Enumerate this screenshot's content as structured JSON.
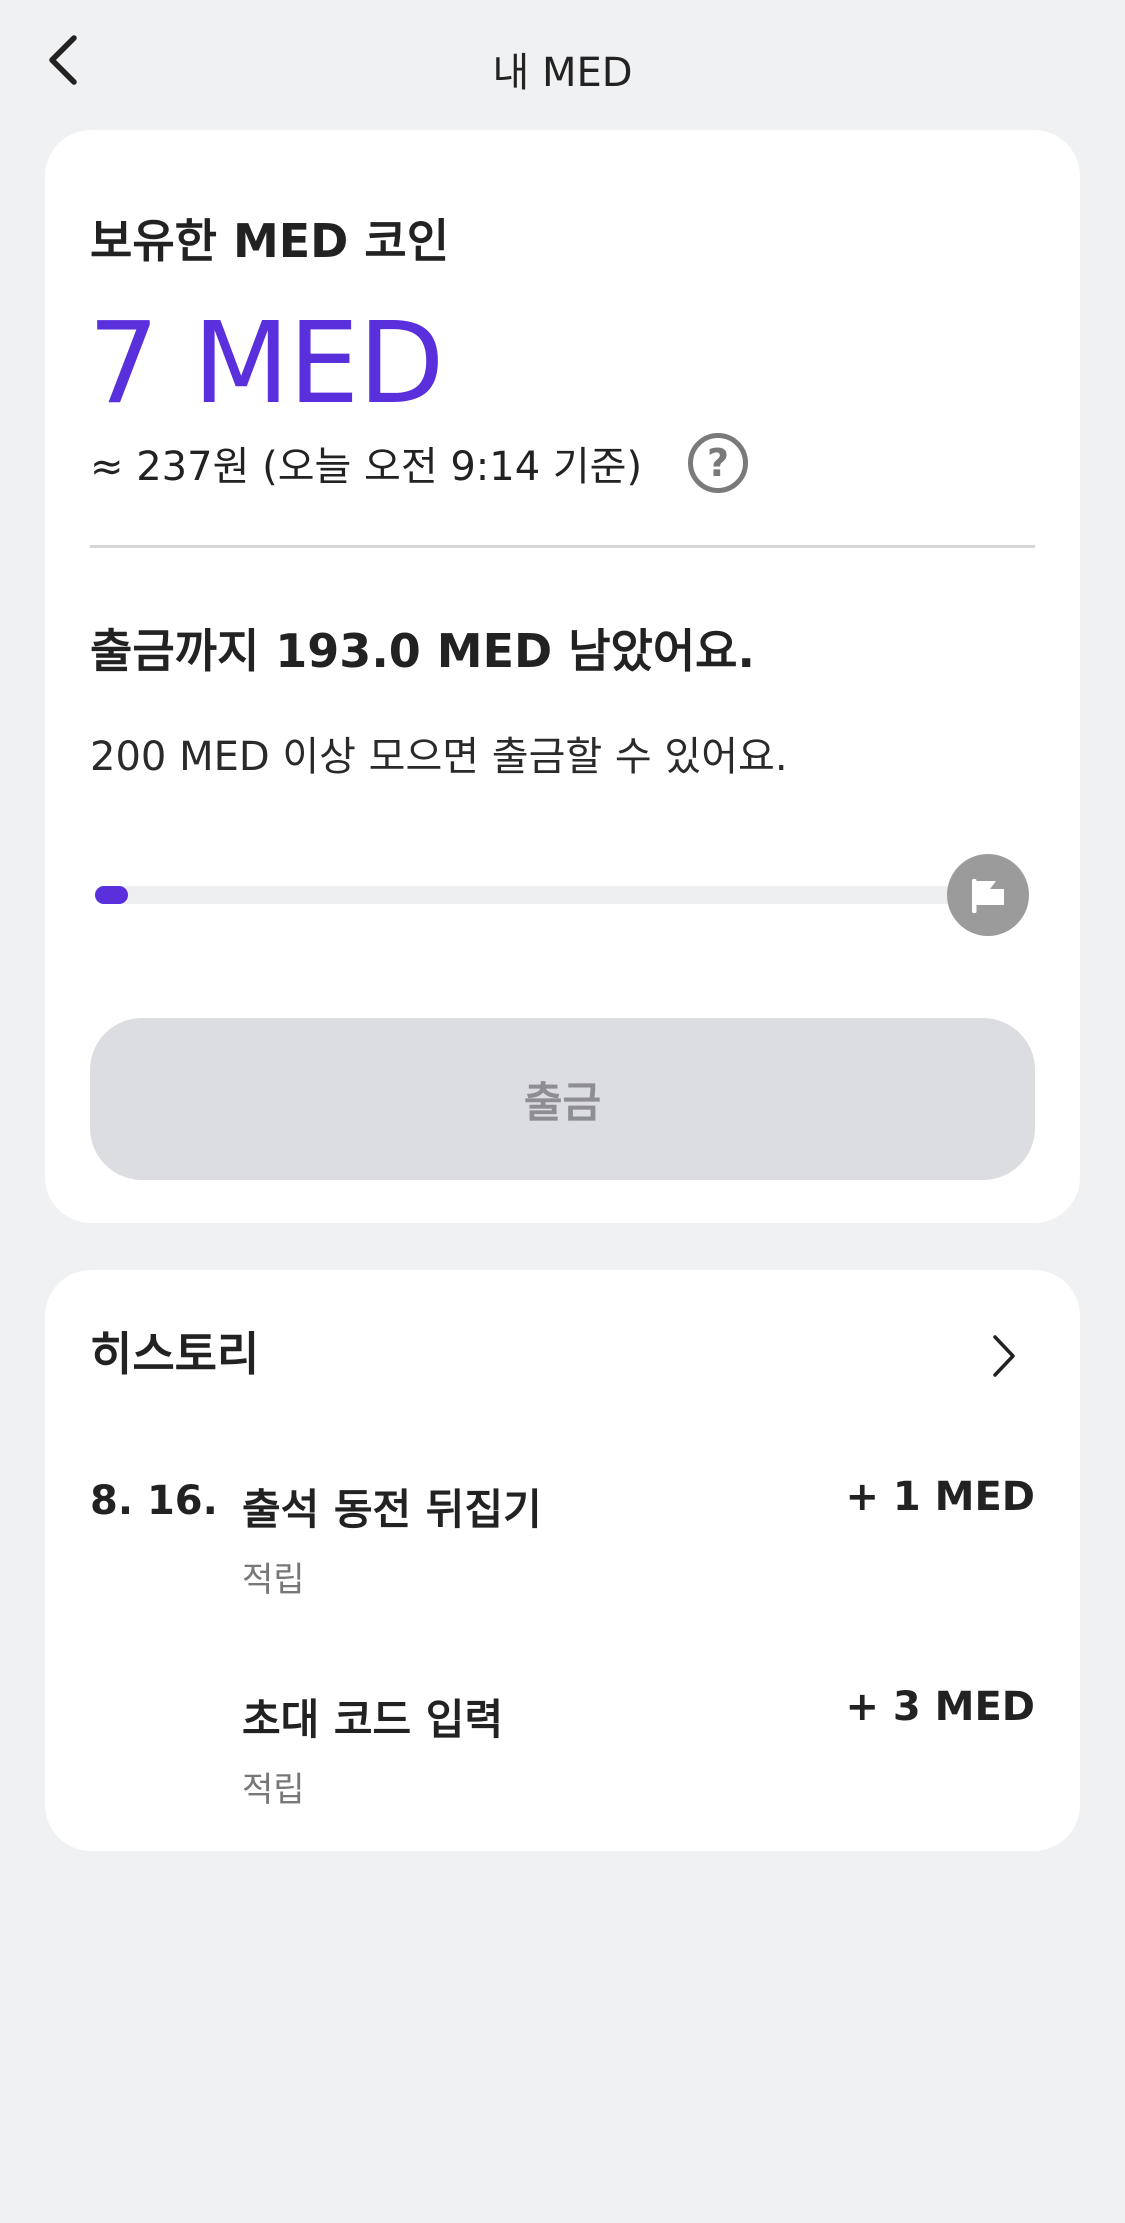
{
  "header": {
    "title": "내 MED",
    "back_icon": "chevron-left-icon"
  },
  "balance": {
    "label": "보유한 MED 코인",
    "amount": "7 MED",
    "krw_estimate": "≈ 237원 (오늘 오전 9:14 기준)",
    "help_icon_glyph": "?",
    "accent_color": "#5a2fdc"
  },
  "withdraw": {
    "remaining_title": "출금까지 193.0 MED 남았어요.",
    "condition_text": "200 MED 이상 모으면 출금할 수 있어요.",
    "progress_fraction": 0.035,
    "goal_icon": "flag-icon",
    "button_label": "출금",
    "button_enabled": false
  },
  "history": {
    "title": "히스토리",
    "more_icon": "chevron-right-icon",
    "items": [
      {
        "date": "8. 16.",
        "title": "출석 동전 뒤집기",
        "type": "적립",
        "amount": "+ 1 MED"
      },
      {
        "date": "",
        "title": "초대 코드 입력",
        "type": "적립",
        "amount": "+ 3 MED"
      }
    ]
  }
}
